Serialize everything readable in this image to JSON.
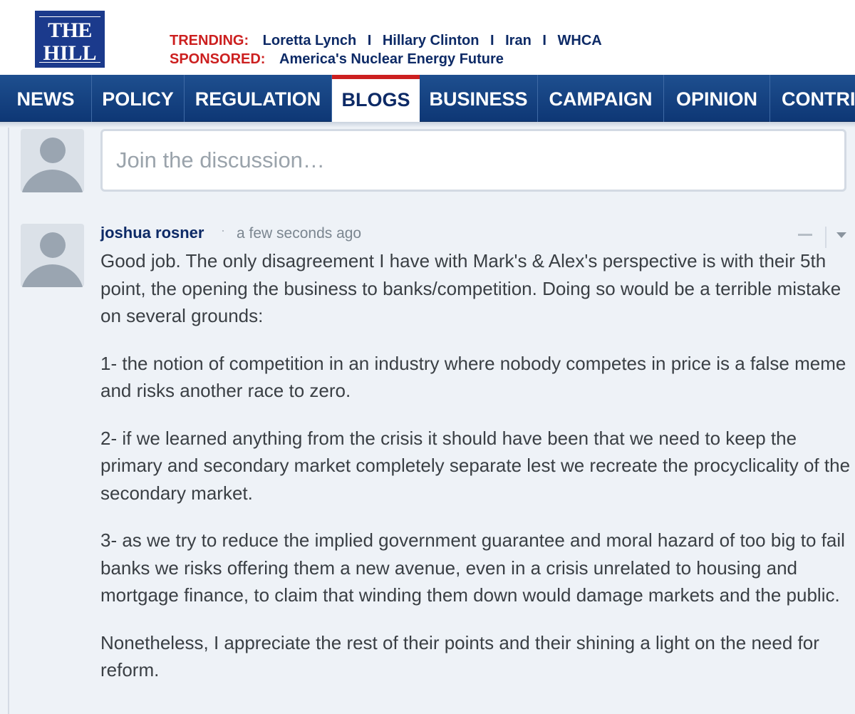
{
  "header": {
    "logo_line1": "THE",
    "logo_line2": "HILL",
    "trending_label": "TRENDING:",
    "trending_items": [
      "Loretta Lynch",
      "Hillary Clinton",
      "Iran",
      "WHCA"
    ],
    "separator": "I",
    "sponsored_label": "SPONSORED:",
    "sponsored_link": "America's Nuclear Energy Future"
  },
  "nav": {
    "items": [
      "NEWS",
      "POLICY",
      "REGULATION",
      "BLOGS",
      "BUSINESS",
      "CAMPAIGN",
      "OPINION",
      "CONTRI"
    ],
    "active": "BLOGS"
  },
  "discussion": {
    "placeholder": "Join the discussion…"
  },
  "comment": {
    "author": "joshua rosner",
    "dot": "·",
    "timestamp": "a few seconds ago",
    "paragraphs": [
      "Good job. The only disagreement I have with Mark's & Alex's perspective is with their 5th point, the opening the business to banks/competition. Doing so would be a terrible mistake on several grounds:",
      "1- the notion of competition in an industry where nobody competes in price is a false meme and risks another race to zero.",
      "2- if we learned anything from the crisis it should have been that we need to keep the primary and secondary market completely separate lest we recreate the procyclicality of the secondary market.",
      "3- as we try to reduce the implied government guarantee and moral hazard of too big to fail banks we risks offering them a new avenue, even in a crisis unrelated to housing and mortgage finance, to claim that winding them down would damage markets and the public.",
      "Nonetheless, I appreciate the rest of their points and their shining a light on the need for reform."
    ]
  },
  "colors": {
    "brand_navy": "#1b3a8c",
    "accent_red": "#cc1f1f",
    "link_navy": "#0d2a66"
  }
}
